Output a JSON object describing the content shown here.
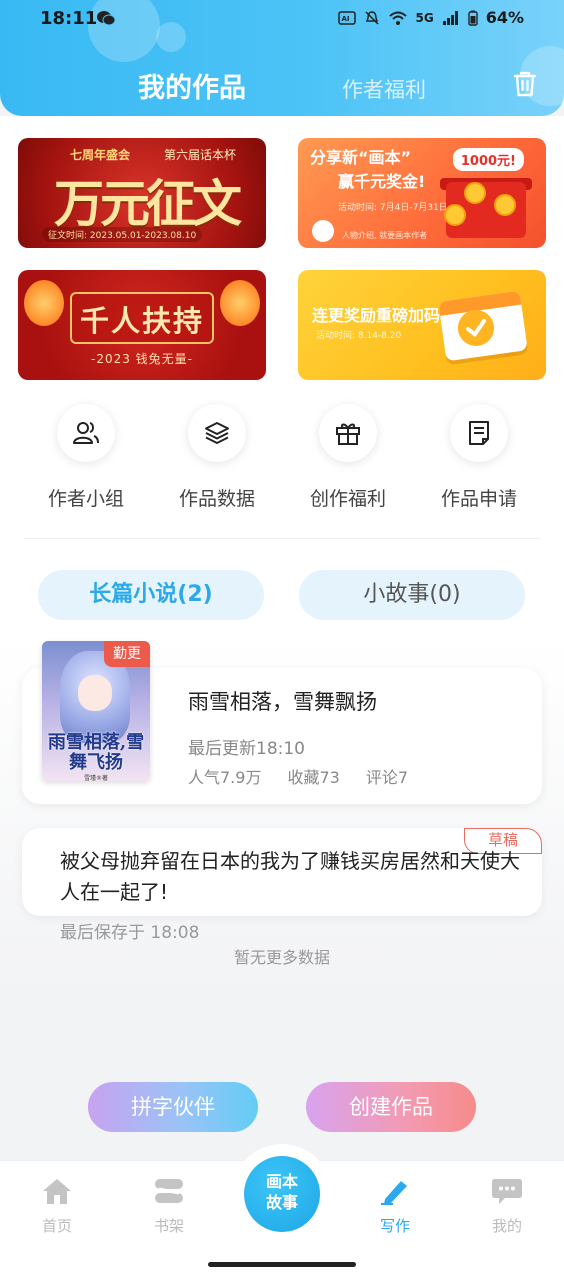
{
  "status_bar": {
    "time": "18:11",
    "network": "5G",
    "battery": "64%"
  },
  "header": {
    "tab_active": "我的作品",
    "tab_inactive": "作者福利",
    "accent_color": "#39b9f3"
  },
  "banners": {
    "b1": {
      "tag_left": "七周年盛会",
      "tag_right": "第六届话本杯",
      "title": "万元征文",
      "date": "征文时间: 2023.05.01-2023.08.10"
    },
    "b2": {
      "line1": "分享新“画本”",
      "line2": "赢千元奖金!",
      "money": "1000元!",
      "small": "活动时间: 7月4日-7月31日",
      "small2": "人物介绍, 就要画本作者"
    },
    "b3": {
      "title": "千人扶持",
      "subtitle": "-2023 钱兔无量-"
    },
    "b4": {
      "title": "连更奖励重磅加码",
      "subtitle": "活动时间: 8.14-8.20"
    }
  },
  "quick_actions": [
    {
      "label": "作者小组",
      "icon": "group-icon"
    },
    {
      "label": "作品数据",
      "icon": "layers-icon"
    },
    {
      "label": "创作福利",
      "icon": "gift-icon"
    },
    {
      "label": "作品申请",
      "icon": "document-icon"
    }
  ],
  "segments": {
    "long": "长篇小说(2)",
    "short": "小故事(0)"
  },
  "work": {
    "badge": "勤更",
    "cover_title": "雨雪相落,雪舞飞扬",
    "cover_author": "雪瑾®著",
    "title": "雨雪相落，雪舞飘扬",
    "updated": "最后更新18:10",
    "popularity": "人气7.9万",
    "favorites": "收藏73",
    "comments": "评论7"
  },
  "draft": {
    "badge": "草稿",
    "title": "被父母抛弃留在日本的我为了赚钱买房居然和天使大人在一起了!",
    "saved": "最后保存于 18:08"
  },
  "no_more": "暂无更多数据",
  "buttons": {
    "partner": "拼字伙伴",
    "create": "创建作品"
  },
  "nav": {
    "home": "首页",
    "shelf": "书架",
    "center": "画本故事",
    "write": "写作",
    "me": "我的",
    "active": "写作"
  }
}
